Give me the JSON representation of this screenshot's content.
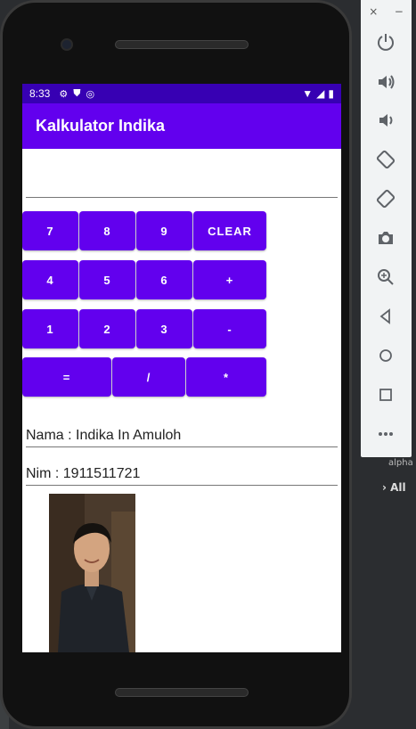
{
  "status_bar": {
    "time": "8:33"
  },
  "app_bar": {
    "title": "Kalkulator Indika"
  },
  "display": {
    "value": ""
  },
  "keypad": {
    "row1": [
      "7",
      "8",
      "9",
      "CLEAR"
    ],
    "row2": [
      "4",
      "5",
      "6",
      "+"
    ],
    "row3": [
      "1",
      "2",
      "3",
      "-"
    ],
    "row4": [
      "=",
      "/",
      "*"
    ]
  },
  "info": {
    "nama": "Nama : Indika In Amuloh",
    "nim": "Nim : 1911511721"
  },
  "emulator_panel": {
    "window_controls": [
      "×",
      "−"
    ],
    "tools": [
      "power-icon",
      "volume-up-icon",
      "volume-down-icon",
      "rotate-left-icon",
      "rotate-right-icon",
      "camera-icon",
      "zoom-icon",
      "back-icon",
      "home-icon",
      "overview-icon",
      "more-icon"
    ]
  },
  "ide": {
    "alpha_text": "alpha",
    "all_text": "All"
  },
  "colors": {
    "primary": "#6200ee",
    "primary_dark": "#3700b3"
  }
}
